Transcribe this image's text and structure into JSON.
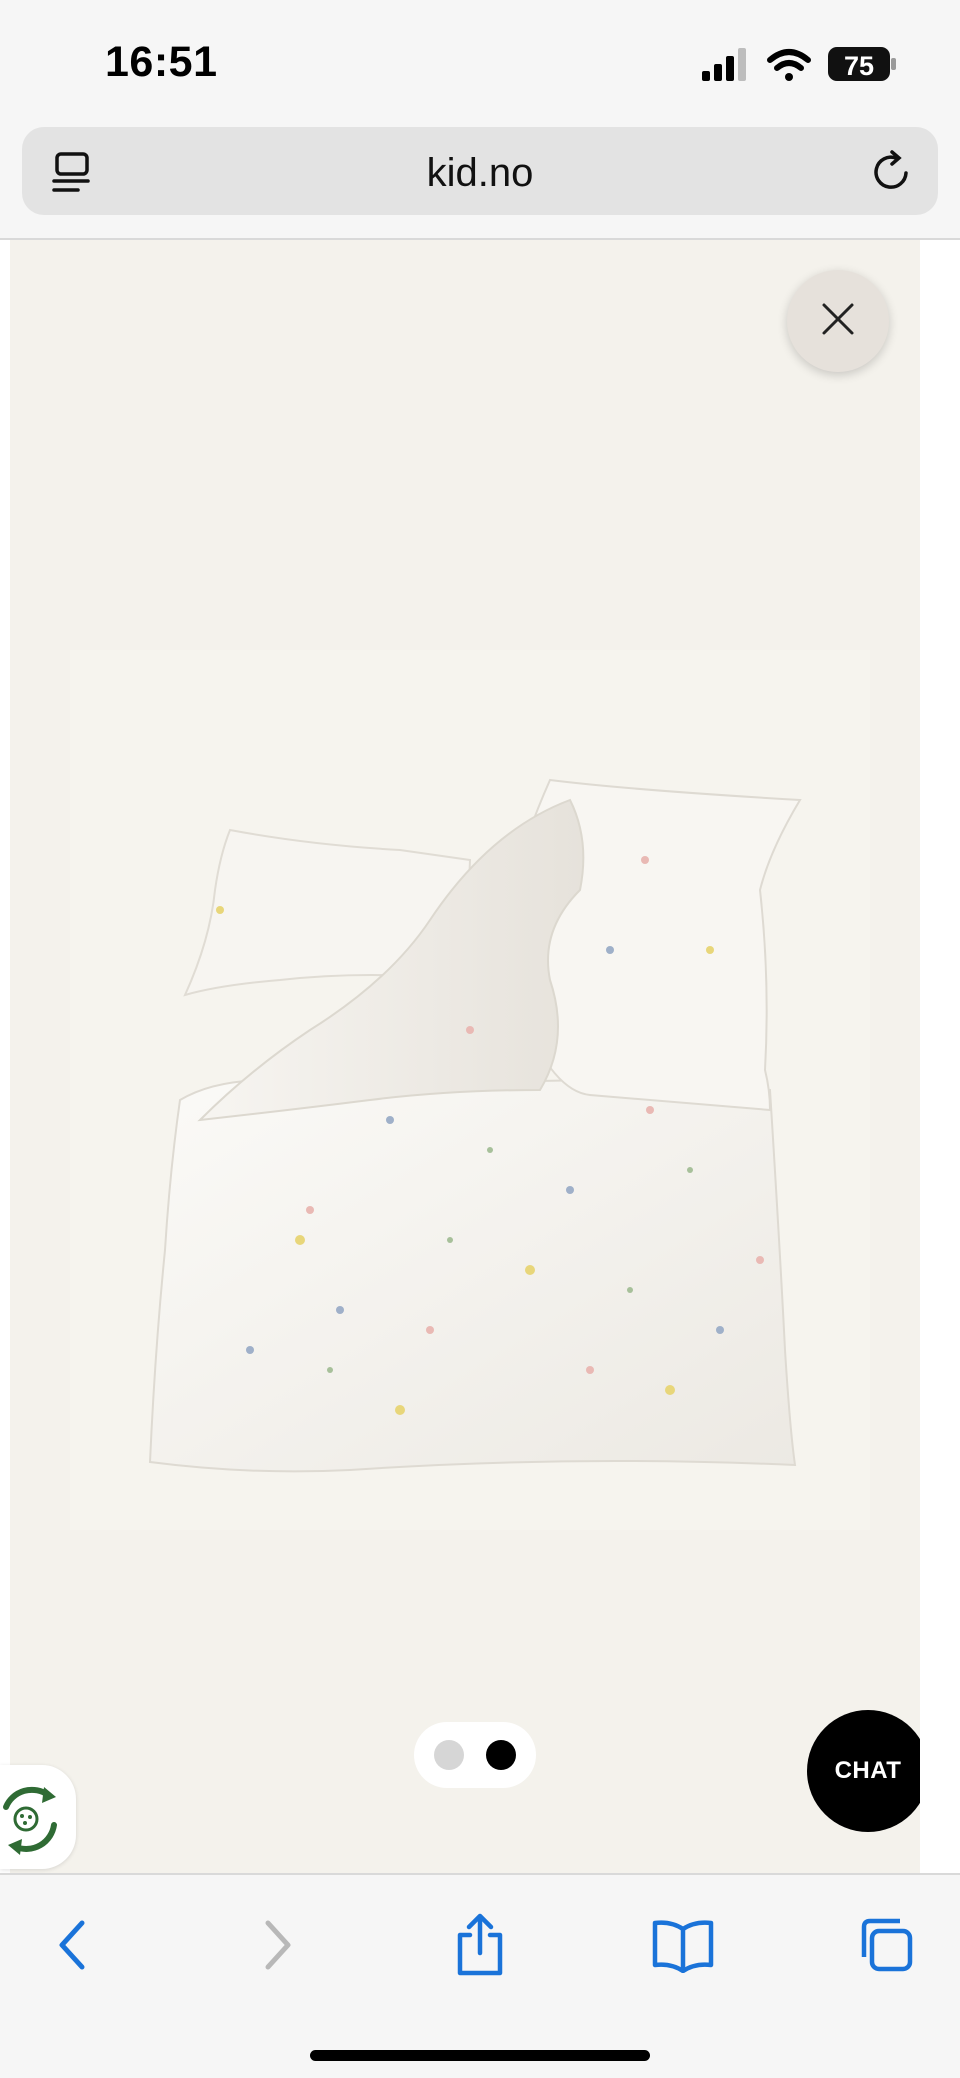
{
  "status_bar": {
    "time": "16:51",
    "battery": "75",
    "icons": [
      "cellular-signal-icon",
      "wifi-icon",
      "battery-icon"
    ]
  },
  "browser": {
    "url": "kid.no",
    "icons": [
      "tab-overview-icon",
      "reload-icon"
    ]
  },
  "gallery": {
    "image_alt": "product-photo",
    "pager": {
      "total": 2,
      "active_index": 1
    },
    "close_icon": "close-icon"
  },
  "chat": {
    "label": "CHAT"
  },
  "eco_badge": {
    "icon": "eco-recycle-icon"
  },
  "toolbar": {
    "buttons": [
      "back-icon",
      "forward-icon",
      "share-icon",
      "bookmarks-icon",
      "tabs-icon"
    ]
  },
  "colors": {
    "accent": "#1a73d9",
    "gallery_bg": "#f4f2ec",
    "chat_bg": "#000000",
    "eco_green": "#2f6b34"
  }
}
